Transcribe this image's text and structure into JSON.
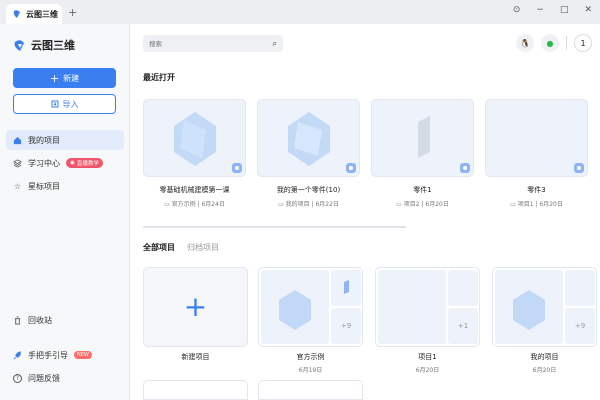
{
  "titlebar": {
    "tab_title": "云图三维",
    "add_tab": "+"
  },
  "window_controls": {
    "pin": "⊙",
    "minimize": "−",
    "maximize": "□",
    "close": "✕"
  },
  "sidebar": {
    "app_name": "云图三维",
    "new_label": "新建",
    "import_label": "导入",
    "nav": [
      {
        "label": "我的项目",
        "active": true
      },
      {
        "label": "学习中心",
        "badge": "直播教学"
      },
      {
        "label": "星标项目"
      }
    ],
    "bottom": [
      {
        "label": "回收站"
      },
      {
        "label": "手把手引导",
        "badge": "NEW"
      },
      {
        "label": "问题反馈"
      }
    ]
  },
  "header": {
    "search_placeholder": "搜索",
    "notification_count": "1"
  },
  "recent": {
    "title": "最近打开",
    "items": [
      {
        "name": "零基础机械建模第一课",
        "meta": "官方示例 | 6月24日"
      },
      {
        "name": "我的第一个零件(10)",
        "meta": "我的项目 | 6月22日"
      },
      {
        "name": "零件1",
        "meta": "项目2 | 6月20日"
      },
      {
        "name": "零件3",
        "meta": "项目1 | 6月20日"
      }
    ]
  },
  "projects": {
    "tabs": [
      "全部项目",
      "归档项目"
    ],
    "items": [
      {
        "name": "新建项目",
        "date": ""
      },
      {
        "name": "官方示例",
        "date": "6月19日",
        "more": "+9"
      },
      {
        "name": "项目1",
        "date": "6月20日",
        "more": "+1"
      },
      {
        "name": "我的项目",
        "date": "6月20日",
        "more": "+9"
      }
    ]
  },
  "colors": {
    "accent": "#3a7ff0",
    "thumb_bg": "#eef2fb",
    "badge": "#f0566a"
  }
}
